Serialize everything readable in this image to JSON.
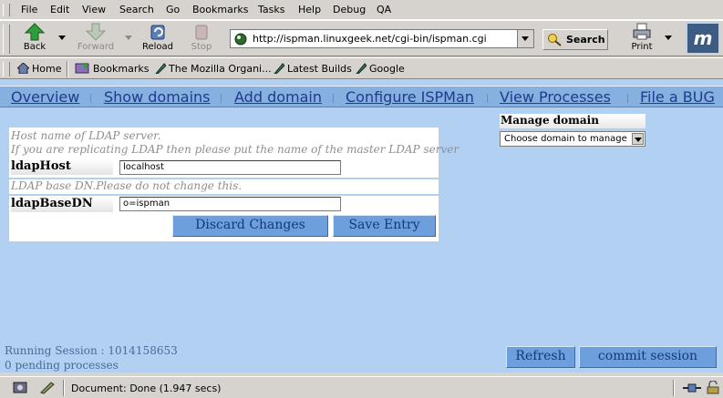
{
  "menu": {
    "items": [
      "File",
      "Edit",
      "View",
      "Search",
      "Go",
      "Bookmarks",
      "Tasks",
      "Help",
      "Debug",
      "QA"
    ]
  },
  "toolbar": {
    "back_label": "Back",
    "forward_label": "Forward",
    "reload_label": "Reload",
    "stop_label": "Stop",
    "url": "http://ispman.linuxgeek.net/cgi-bin/ispman.cgi",
    "search_label": "Search",
    "print_label": "Print",
    "logo_letter": "m"
  },
  "personal": {
    "items": [
      "Home",
      "Bookmarks",
      "The Mozilla Organi...",
      "Latest Builds",
      "Google"
    ]
  },
  "nav": {
    "items": [
      "Overview",
      "Show domains",
      "Add domain",
      "Configure ISPMan",
      "View Processes",
      "File a BUG"
    ]
  },
  "form": {
    "host_help_1": "Host name of LDAP server.",
    "host_help_2": "If you are replicating LDAP then please put the name of the master LDAP server",
    "host_label": "ldapHost",
    "host_value": "localhost",
    "basedn_help": "LDAP base DN.Please do not change this.",
    "basedn_label": "ldapBaseDN",
    "basedn_value": "o=ispman",
    "discard_label": "Discard Changes",
    "save_label": "Save Entry"
  },
  "manage": {
    "title": "Manage domain",
    "select_value": "Choose domain to manage"
  },
  "session": {
    "running": "Running Session : 1014158653",
    "pending": "0 pending processes",
    "refresh_label": "Refresh",
    "commit_label": "commit session"
  },
  "status": {
    "text": "Document: Done (1.947 secs)"
  },
  "colors": {
    "content_bg": "#b2d0f1",
    "nav_bg": "#86b0e0",
    "button_bg": "#6d9fdc",
    "link": "#1f3b8c"
  }
}
